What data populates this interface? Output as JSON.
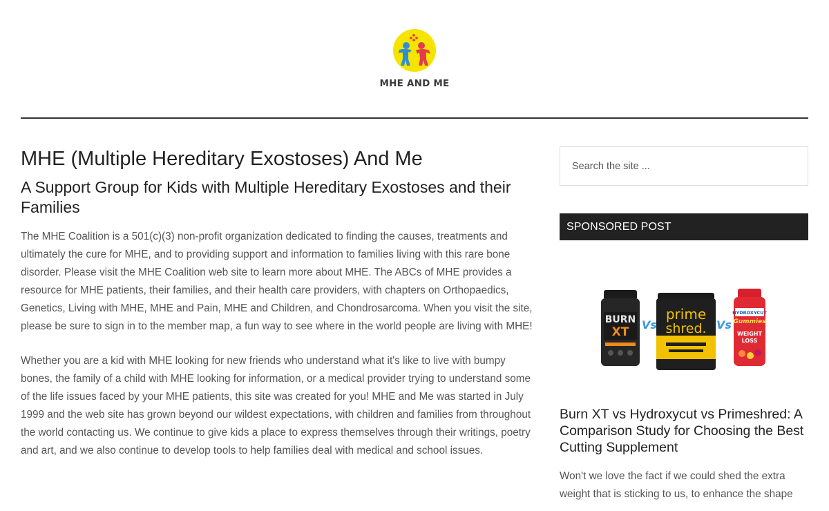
{
  "header": {
    "site_title": "MHE AND ME"
  },
  "main": {
    "title": "MHE (Multiple Hereditary Exostoses) And Me",
    "subtitle": "A Support Group for Kids with Multiple Hereditary Exostoses and their Families",
    "paragraphs": [
      "The MHE Coalition is a 501(c)(3) non-profit organization dedicated to finding the causes, treatments and ultimately the cure for MHE, and to providing support and information to families living with this rare bone disorder. Please visit the MHE Coalition web site to learn more about MHE. The ABCs of MHE provides a resource for MHE patients, their families, and their health care providers, with chapters on Orthopaedics, Genetics, Living with MHE, MHE and Pain, MHE and Children, and Chondrosarcoma. When you visit the site, please be sure to sign in to the member map, a fun way to see where in the world people are living with MHE!",
      "Whether you are a kid with MHE looking for new friends who understand what it's like to live with bumpy bones, the family of a child with MHE looking for information, or a medical provider trying to understand some of the life issues faced by your MHE patients, this site was created for you! MHE and Me was started in July 1999 and the web site has grown beyond our wildest expectations, with children and families from throughout the world contacting us. We continue to give kids a place to express themselves through their writings, poetry and art, and we also continue to develop tools to help families deal with medical and school issues."
    ]
  },
  "sidebar": {
    "search": {
      "placeholder": "Search the site ..."
    },
    "widget_title": "SPONSORED POST",
    "product_image": {
      "labels": {
        "burn_line1": "BURN",
        "burn_line2": "XT",
        "vs1": "Vs",
        "prime_line1": "prime",
        "prime_line2": "shred.",
        "vs2": "Vs",
        "hydroxy_brand": "HYDROXYCUT",
        "hydroxy_sub": "Gummies",
        "hydroxy_line1": "WEIGHT",
        "hydroxy_line2": "LOSS"
      }
    },
    "post": {
      "title": "Burn XT vs Hydroxycut vs Primeshred: A Comparison Study for Choosing the Best Cutting Supplement",
      "excerpt": "Won't we love the fact if we could shed the extra weight that is sticking to us, to enhance the shape"
    }
  },
  "colors": {
    "logo_yellow": "#f5e400",
    "header_rule": "#333333",
    "widget_title_bg": "#222222"
  }
}
